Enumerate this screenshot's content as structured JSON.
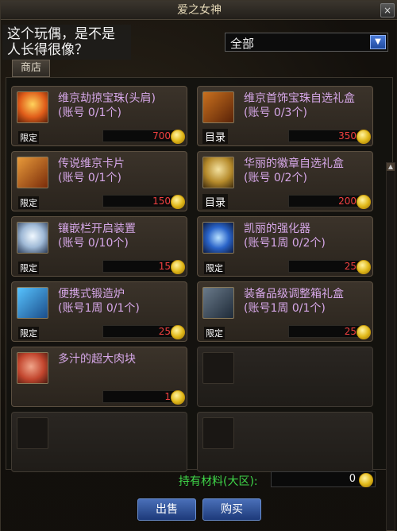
{
  "window": {
    "title": "爱之女神",
    "close": "×"
  },
  "scene_text": "这个玩偶，是不是人长得很像？",
  "filter": {
    "selected": "全部"
  },
  "tabs": [
    {
      "label": "商店"
    }
  ],
  "badge_text": "限定",
  "catalog_text": "目录",
  "items": [
    {
      "name": "维京劫掠宝珠(头肩)",
      "limit": "(账号 0/1个)",
      "price": "700",
      "icon": "fire-orb-icon"
    },
    {
      "name": "维京首饰宝珠自选礼盒",
      "limit": "(账号 0/3个)",
      "price": "350",
      "icon": "gift-box-icon"
    },
    {
      "name": "传说维京卡片",
      "limit": "(账号 0/1个)",
      "price": "150",
      "icon": "card-icon"
    },
    {
      "name": "华丽的徽章自选礼盒",
      "limit": "(账号 0/2个)",
      "price": "200",
      "icon": "emblem-box-icon"
    },
    {
      "name": "镶嵌栏开启装置",
      "limit": "(账号 0/10个)",
      "price": "15",
      "icon": "socket-icon"
    },
    {
      "name": "凯丽的强化器",
      "limit": "(账号1周 0/2个)",
      "price": "25",
      "icon": "reinforcer-icon"
    },
    {
      "name": "便携式锻造炉",
      "limit": "(账号1周 0/1个)",
      "price": "25",
      "icon": "forge-icon"
    },
    {
      "name": "装备品级调整箱礼盒",
      "limit": "(账号1周 0/1个)",
      "price": "25",
      "icon": "chest-icon"
    },
    {
      "name": "多汁的超大肉块",
      "limit": "",
      "price": "1",
      "icon": "meat-icon"
    }
  ],
  "footer": {
    "label": "持有材料(大区):",
    "value": "0"
  },
  "buttons": {
    "sell": "出售",
    "buy": "购买"
  },
  "colors": {
    "name": "#d6a7e8",
    "price": "#f04040",
    "footer_label": "#3fd84a",
    "button": "#2d4f9a"
  }
}
